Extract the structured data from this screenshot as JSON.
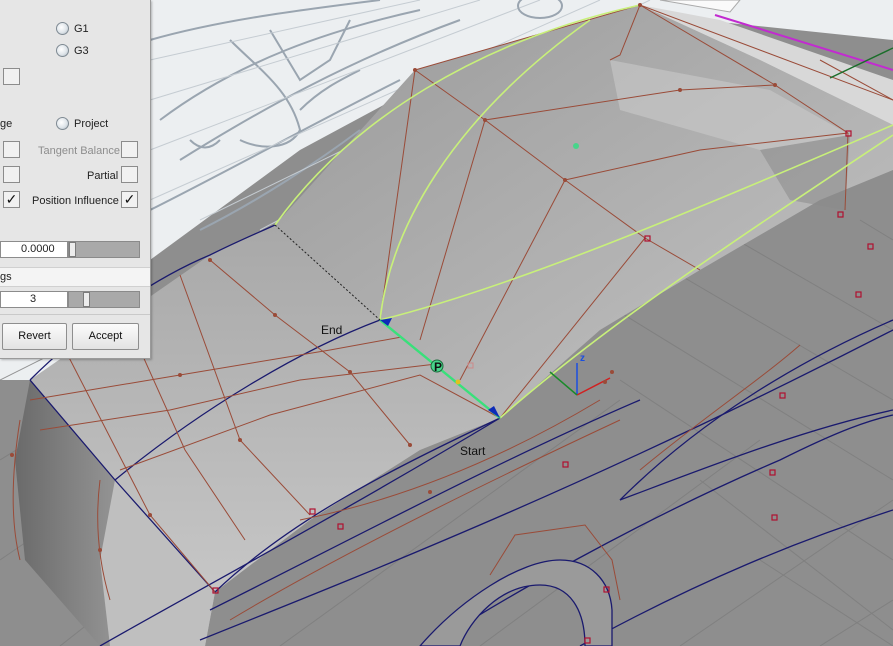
{
  "viewport": {
    "labels": {
      "end": "End",
      "start": "Start",
      "point": "P",
      "z_axis": "z"
    },
    "colors": {
      "surface": "#b4b4b4",
      "hull": "#9a4b38",
      "isoparm": "#1a1a6e",
      "highlight_curve": "#c8f07a",
      "selected_edge": "#39e07a",
      "magenta": "#c22bd0",
      "background": "#e8ecef"
    }
  },
  "panel": {
    "continuity": {
      "g1_label": "G1",
      "g3_label": "G3"
    },
    "mode": {
      "edge_label_partial": "ge",
      "project_label": "Project"
    },
    "options": {
      "tangent_balance_label": "Tangent Balance",
      "partial_label": "Partial",
      "position_influence_label": "Position Influence",
      "position_influence_checked": "✓",
      "left_checked": "✓"
    },
    "value_field": "0.0000",
    "section_label_partial": "gs",
    "spans_field": "3",
    "buttons": {
      "revert": "Revert",
      "accept": "Accept"
    }
  }
}
